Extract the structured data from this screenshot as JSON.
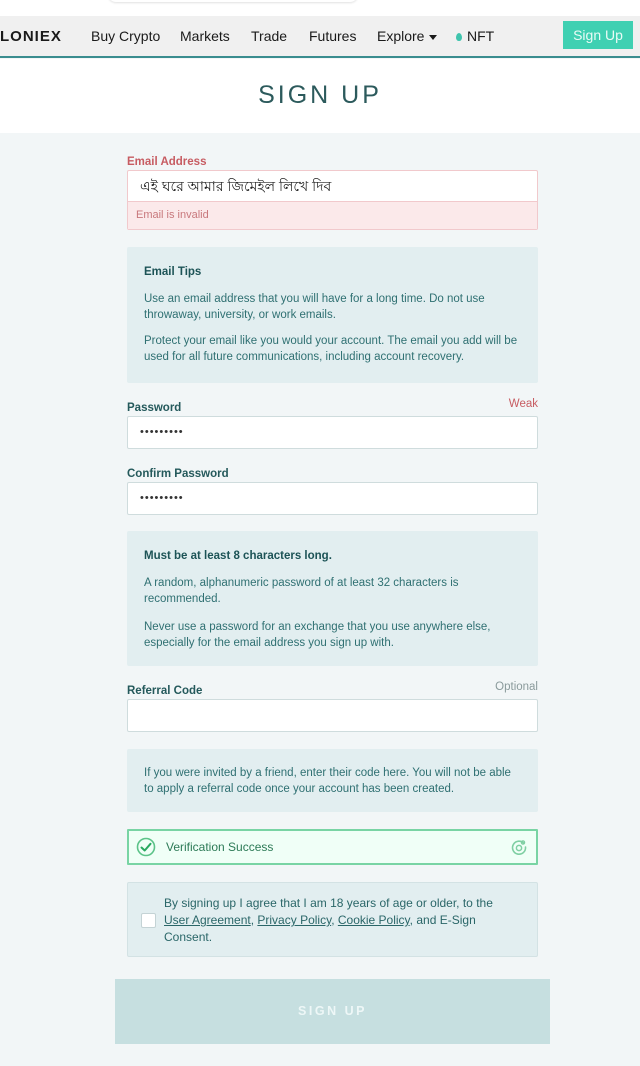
{
  "navbar": {
    "logo": "LONIEX",
    "items": [
      "Buy Crypto",
      "Markets",
      "Trade",
      "Futures",
      "Explore",
      "NFT"
    ],
    "signup_label": "Sign Up"
  },
  "page": {
    "title": "SIGN UP"
  },
  "email": {
    "label": "Email Address",
    "value": "এই ঘরে আমার জিমেইল লিখে দিব",
    "error": "Email is invalid"
  },
  "email_tips": {
    "heading": "Email Tips",
    "p1": "Use an email address that you will have for a long time. Do not use throwaway, university, or work emails.",
    "p2": "Protect your email like you would your account. The email you add will be used for all future communications, including account recovery."
  },
  "password": {
    "label": "Password",
    "strength": "Weak",
    "value": "•••••••••"
  },
  "confirm_password": {
    "label": "Confirm Password",
    "value": "•••••••••"
  },
  "password_tips": {
    "heading": "Must be at least 8 characters long.",
    "p1": "A random, alphanumeric password of at least 32 characters is recommended.",
    "p2": "Never use a password for an exchange that you use anywhere else, especially for the email address you sign up with."
  },
  "referral": {
    "label": "Referral Code",
    "optional": "Optional",
    "value": "",
    "tip": "If you were invited by a friend, enter their code here. You will not be able to apply a referral code once your account has been created."
  },
  "verification": {
    "status": "Verification Success"
  },
  "agreement": {
    "prefix": "By signing up I agree that I am 18 years of age or older, to the",
    "user_agreement": "User Agreement",
    "privacy_policy": "Privacy Policy",
    "cookie_policy": "Cookie Policy",
    "and": ", and",
    "esign": "E-Sign",
    "consent": "Consent.",
    "checked": false
  },
  "submit_label": "SIGN UP",
  "colors": {
    "accent": "#3fd0b2",
    "error": "#c75c62",
    "success": "#79d4a4",
    "text_teal": "#24595b"
  }
}
